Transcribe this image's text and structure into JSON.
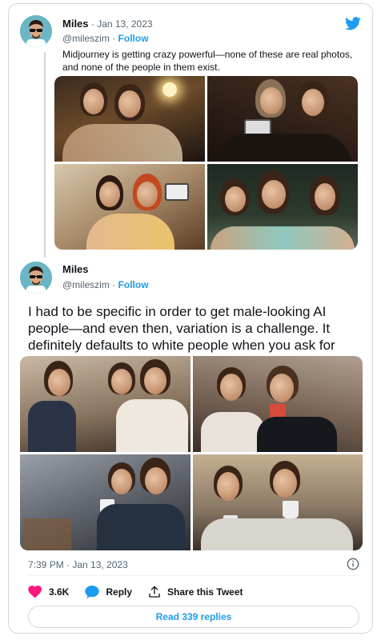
{
  "tweet1": {
    "author_name": "Miles",
    "date": "Jan 13, 2023",
    "separator": " · ",
    "handle": "@mileszim",
    "dot": " · ",
    "follow_label": "Follow",
    "text": "Midjourney is getting crazy powerful—none of these are real photos, and none of the people in them exist."
  },
  "tweet2": {
    "author_name": "Miles",
    "handle": "@mileszim",
    "dot": " · ",
    "follow_label": "Follow",
    "text": "I had to be specific in order to get male-looking AI people—and even then, variation is a challenge. It definitely defaults to white people when you ask for “people”.",
    "timestamp": "7:39 PM · Jan 13, 2023"
  },
  "actions": {
    "likes": "3.6K",
    "reply_label": "Reply",
    "share_label": "Share this Tweet"
  },
  "read_replies_label": "Read 339 replies",
  "colors": {
    "accent": "#1d9bf0",
    "like": "#f91880",
    "avatar_bg": "#6bb6c4"
  },
  "icons": [
    "twitter-bird-icon",
    "heart-icon",
    "reply-bubble-icon",
    "share-icon",
    "info-icon"
  ]
}
